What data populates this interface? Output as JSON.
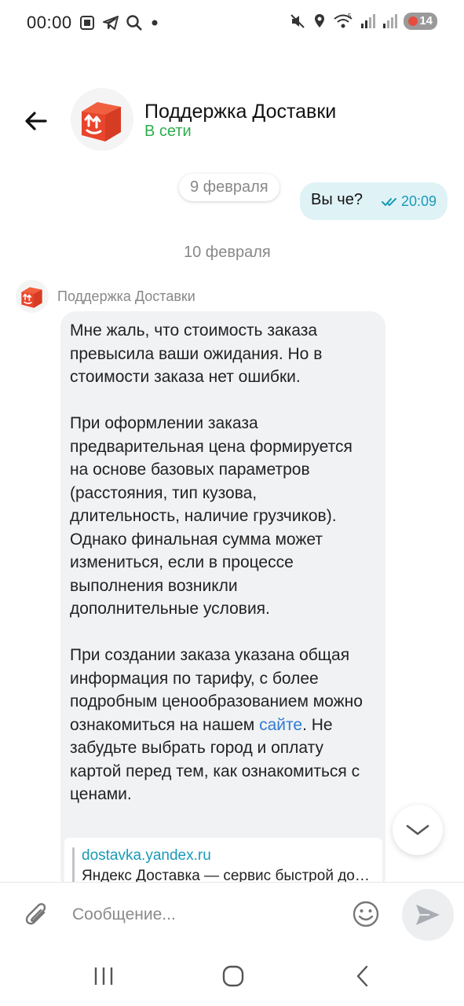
{
  "status_bar": {
    "time": "00:00",
    "battery": "14",
    "network": "5"
  },
  "header": {
    "title": "Поддержка Доставки",
    "status": "В сети",
    "status_color": "#2fae4e"
  },
  "messages": {
    "date_1": "9 февраля",
    "outgoing": {
      "text": "Вы че?",
      "time": "20:09"
    },
    "date_2": "10 февраля",
    "incoming": {
      "sender": "Поддержка Доставки",
      "p1": "Мне жаль, что стоимость заказа превысила ваши ожидания. Но в стоимости заказа нет ошибки.",
      "p2": "При оформлении заказа предварительная цена формируется на основе базовых параметров (расстояния, тип кузова, длительность, наличие грузчиков). Однако финальная сумма может измениться, если в процессе выполнения возникли дополнительные условия.",
      "p3_before": "При создании заказа указана общая информация по тарифу, с более подробным ценообразованием можно ознакомиться на нашем ",
      "p3_link": "сайте",
      "p3_after": ". Не забудьте выбрать город и оплату картой перед тем, как ознакомиться с ценами.",
      "preview_url": "dostavka.yandex.ru",
      "preview_title": "Яндекс Доставка — сервис быстрой доставки"
    }
  },
  "composer": {
    "placeholder": "Сообщение..."
  },
  "colors": {
    "accent": "#1a9ab8",
    "link": "#2f7bd2",
    "brand": "#e8452c"
  }
}
